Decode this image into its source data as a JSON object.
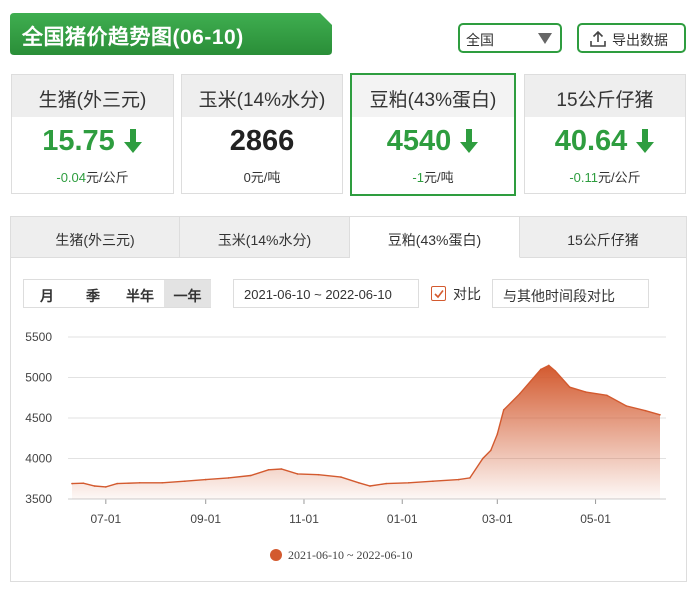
{
  "header": {
    "title": "全国猪价趋势图(06-10)",
    "region": "全国",
    "export_label": "导出数据",
    "green": "#2e9d3f"
  },
  "cards": [
    {
      "name": "生猪(外三元)",
      "value": "15.75",
      "change": "-0.04",
      "unit": "元/公斤",
      "trend": "down",
      "active": false
    },
    {
      "name": "玉米(14%水分)",
      "value": "2866",
      "change": "0",
      "unit": "元/吨",
      "trend": "flat",
      "active": false
    },
    {
      "name": "豆粕(43%蛋白)",
      "value": "4540",
      "change": "-1",
      "unit": "元/吨",
      "trend": "down",
      "active": true
    },
    {
      "name": "15公斤仔猪",
      "value": "40.64",
      "change": "-0.11",
      "unit": "元/公斤",
      "trend": "down",
      "active": false
    }
  ],
  "tabs": [
    {
      "label": "生猪(外三元)",
      "active": false
    },
    {
      "label": "玉米(14%水分)",
      "active": false
    },
    {
      "label": "豆粕(43%蛋白)",
      "active": true
    },
    {
      "label": "15公斤仔猪",
      "active": false
    }
  ],
  "controls": {
    "periods": [
      {
        "label": "月",
        "active": false
      },
      {
        "label": "季",
        "active": false
      },
      {
        "label": "半年",
        "active": false
      },
      {
        "label": "一年",
        "active": true
      }
    ],
    "date_range": "2021-06-10 ~ 2022-06-10",
    "compare_checked": true,
    "compare_label": "对比",
    "compare_placeholder": "与其他时间段对比"
  },
  "chart_data": {
    "type": "area",
    "series": [
      {
        "name": "2021-06-10 ~ 2022-06-10",
        "color": "#d35a2f",
        "points": [
          [
            "2021-06-10",
            3690
          ],
          [
            "2021-06-17",
            3695
          ],
          [
            "2021-06-24",
            3660
          ],
          [
            "2021-07-01",
            3650
          ],
          [
            "2021-07-08",
            3690
          ],
          [
            "2021-07-22",
            3700
          ],
          [
            "2021-08-05",
            3700
          ],
          [
            "2021-08-19",
            3720
          ],
          [
            "2021-09-01",
            3740
          ],
          [
            "2021-09-15",
            3760
          ],
          [
            "2021-09-29",
            3790
          ],
          [
            "2021-10-10",
            3860
          ],
          [
            "2021-10-18",
            3870
          ],
          [
            "2021-10-28",
            3810
          ],
          [
            "2021-11-10",
            3800
          ],
          [
            "2021-11-24",
            3770
          ],
          [
            "2021-12-05",
            3700
          ],
          [
            "2021-12-12",
            3660
          ],
          [
            "2021-12-22",
            3690
          ],
          [
            "2022-01-05",
            3700
          ],
          [
            "2022-01-20",
            3720
          ],
          [
            "2022-02-05",
            3740
          ],
          [
            "2022-02-12",
            3760
          ],
          [
            "2022-02-20",
            4000
          ],
          [
            "2022-02-25",
            4100
          ],
          [
            "2022-03-01",
            4300
          ],
          [
            "2022-03-05",
            4600
          ],
          [
            "2022-03-15",
            4800
          ],
          [
            "2022-03-28",
            5100
          ],
          [
            "2022-04-02",
            5150
          ],
          [
            "2022-04-06",
            5080
          ],
          [
            "2022-04-15",
            4880
          ],
          [
            "2022-04-25",
            4820
          ],
          [
            "2022-05-08",
            4780
          ],
          [
            "2022-05-20",
            4650
          ],
          [
            "2022-06-01",
            4590
          ],
          [
            "2022-06-10",
            4540
          ]
        ]
      }
    ],
    "xaxis": {
      "ticks": [
        "2021-07-01",
        "2021-09-01",
        "2021-11-01",
        "2022-01-01",
        "2022-03-01",
        "2022-05-01"
      ],
      "tick_labels": [
        "07-01",
        "09-01",
        "11-01",
        "01-01",
        "03-01",
        "05-01"
      ],
      "range": [
        "2021-06-10",
        "2022-06-10"
      ]
    },
    "yaxis": {
      "ticks": [
        3500,
        4000,
        4500,
        5000,
        5500
      ],
      "range": [
        3500,
        5500
      ]
    },
    "grid": "horizontal",
    "legend": "bottom-center"
  }
}
